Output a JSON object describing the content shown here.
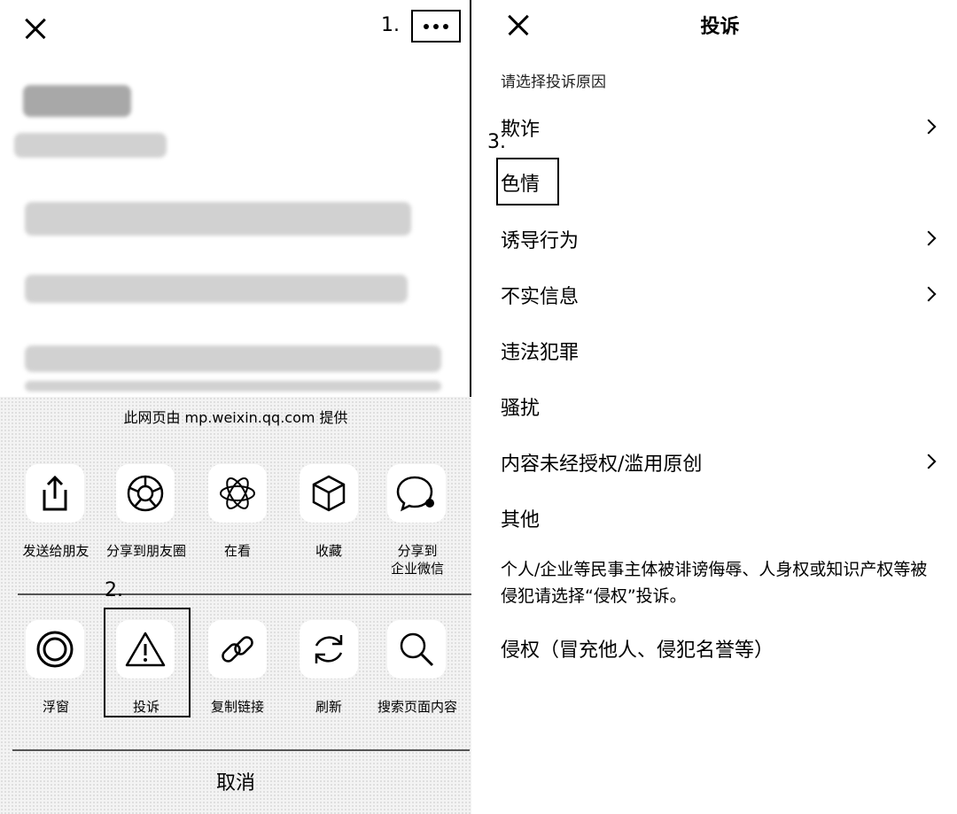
{
  "left": {
    "step1": "1.",
    "step2": "2.",
    "provider": "此网页由 mp.weixin.qq.com 提供",
    "share_row": [
      {
        "icon": "share-upload-icon",
        "label": "发送给朋友"
      },
      {
        "icon": "moments-icon",
        "label": "分享到朋友圈"
      },
      {
        "icon": "wow-icon",
        "label": "在看"
      },
      {
        "icon": "favorite-cube-icon",
        "label": "收藏"
      },
      {
        "icon": "wecom-icon",
        "label": "分享到\n企业微信"
      }
    ],
    "action_row": [
      {
        "icon": "float-window-icon",
        "label": "浮窗"
      },
      {
        "icon": "warning-icon",
        "label": "投诉"
      },
      {
        "icon": "link-icon",
        "label": "复制链接"
      },
      {
        "icon": "refresh-icon",
        "label": "刷新"
      },
      {
        "icon": "search-icon",
        "label": "搜索页面内容"
      }
    ],
    "cancel": "取消"
  },
  "right": {
    "title": "投诉",
    "hint": "请选择投诉原因",
    "step3": "3.",
    "reasons": [
      {
        "label": "欺诈",
        "chevron": true
      },
      {
        "label": "色情",
        "chevron": false
      },
      {
        "label": "诱导行为",
        "chevron": true
      },
      {
        "label": "不实信息",
        "chevron": true
      },
      {
        "label": "违法犯罪",
        "chevron": false
      },
      {
        "label": "骚扰",
        "chevron": false
      },
      {
        "label": "内容未经授权/滥用原创",
        "chevron": true
      },
      {
        "label": "其他",
        "chevron": false
      }
    ],
    "note": "个人/企业等民事主体被诽谤侮辱、人身权或知识产权等被侵犯请选择“侵权”投诉。",
    "infringement": "侵权（冒充他人、侵犯名誉等）"
  }
}
